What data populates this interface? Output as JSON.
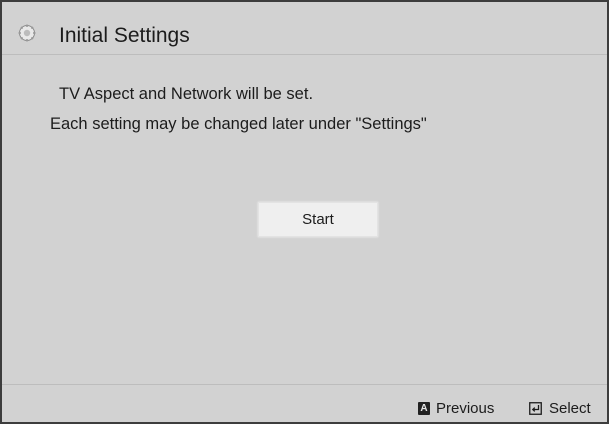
{
  "header": {
    "icon": "gear-icon",
    "title": "Initial Settings"
  },
  "message": {
    "line1": "TV Aspect and Network will be set.",
    "line2": "Each setting may be changed later under \"Settings\""
  },
  "actions": {
    "start_label": "Start"
  },
  "footer": {
    "previous": {
      "key": "A",
      "label": "Previous"
    },
    "select": {
      "icon": "enter-icon",
      "label": "Select"
    }
  },
  "colors": {
    "background": "#d2d2d2",
    "text": "#1c1c1c",
    "button": "#efefef",
    "frame": "#3d3d3d",
    "divider": "#bdbdbd"
  }
}
